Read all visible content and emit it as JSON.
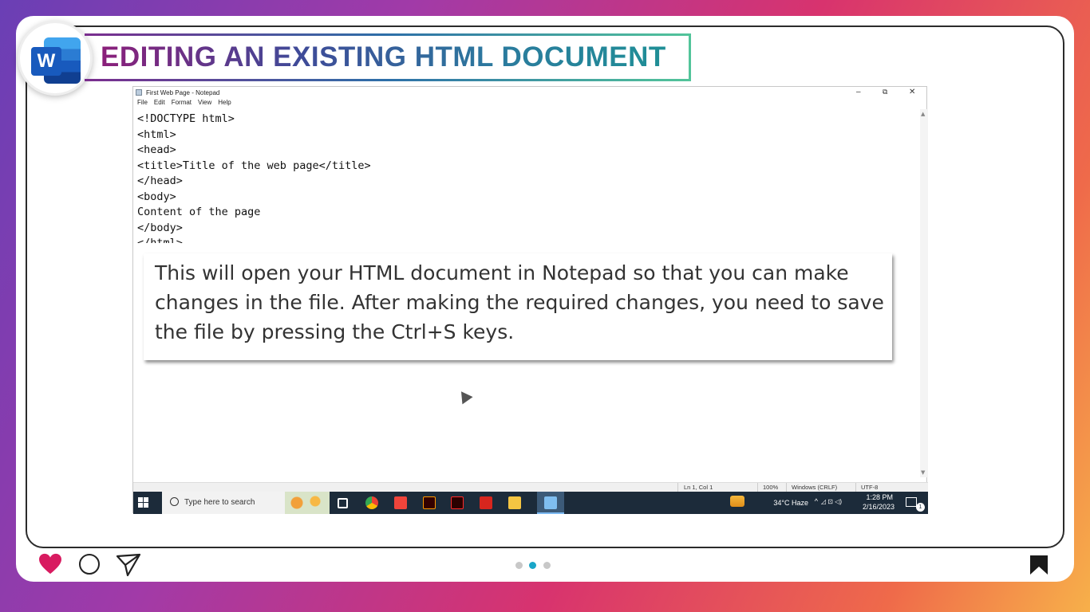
{
  "slide": {
    "title": "EDITING AN EXISTING HTML DOCUMENT",
    "logo_letter": "W",
    "caption": "This will open your HTML document in Notepad so that you can make changes in the file. After making the required changes, you need to save the file by pressing the Ctrl+S keys."
  },
  "notepad": {
    "window_title": "First Web Page - Notepad",
    "controls": {
      "minimize": "–",
      "restore": "⧉",
      "close": "✕"
    },
    "menu": [
      "File",
      "Edit",
      "Format",
      "View",
      "Help"
    ],
    "code_lines": [
      "<!DOCTYPE html>",
      "<html>",
      "<head>",
      "<title>Title of the web page</title>",
      "</head>",
      "<body>",
      "Content of the page",
      "</body>",
      "</html>"
    ],
    "status": {
      "position": "Ln 1, Col 1",
      "zoom": "100%",
      "line_ending": "Windows (CRLF)",
      "encoding": "UTF-8"
    }
  },
  "taskbar": {
    "search_placeholder": "Type here to search",
    "weather": "34°C  Haze",
    "time": "1:28 PM",
    "date": "2/16/2023",
    "notification_count": "1",
    "app_icons": [
      "task-view-icon",
      "chrome-icon",
      "anydesk-icon",
      "illustrator-icon",
      "acrobat-dc-icon",
      "acrobat-reader-icon",
      "file-explorer-icon",
      "notepad-icon"
    ]
  },
  "social": {
    "icons": [
      "heart-icon",
      "comment-icon",
      "send-icon",
      "bookmark-icon"
    ],
    "colors": {
      "heart": "#d81b60",
      "active_dot": "#1aa6c8"
    },
    "pager_active": 2,
    "pager_total": 3
  }
}
